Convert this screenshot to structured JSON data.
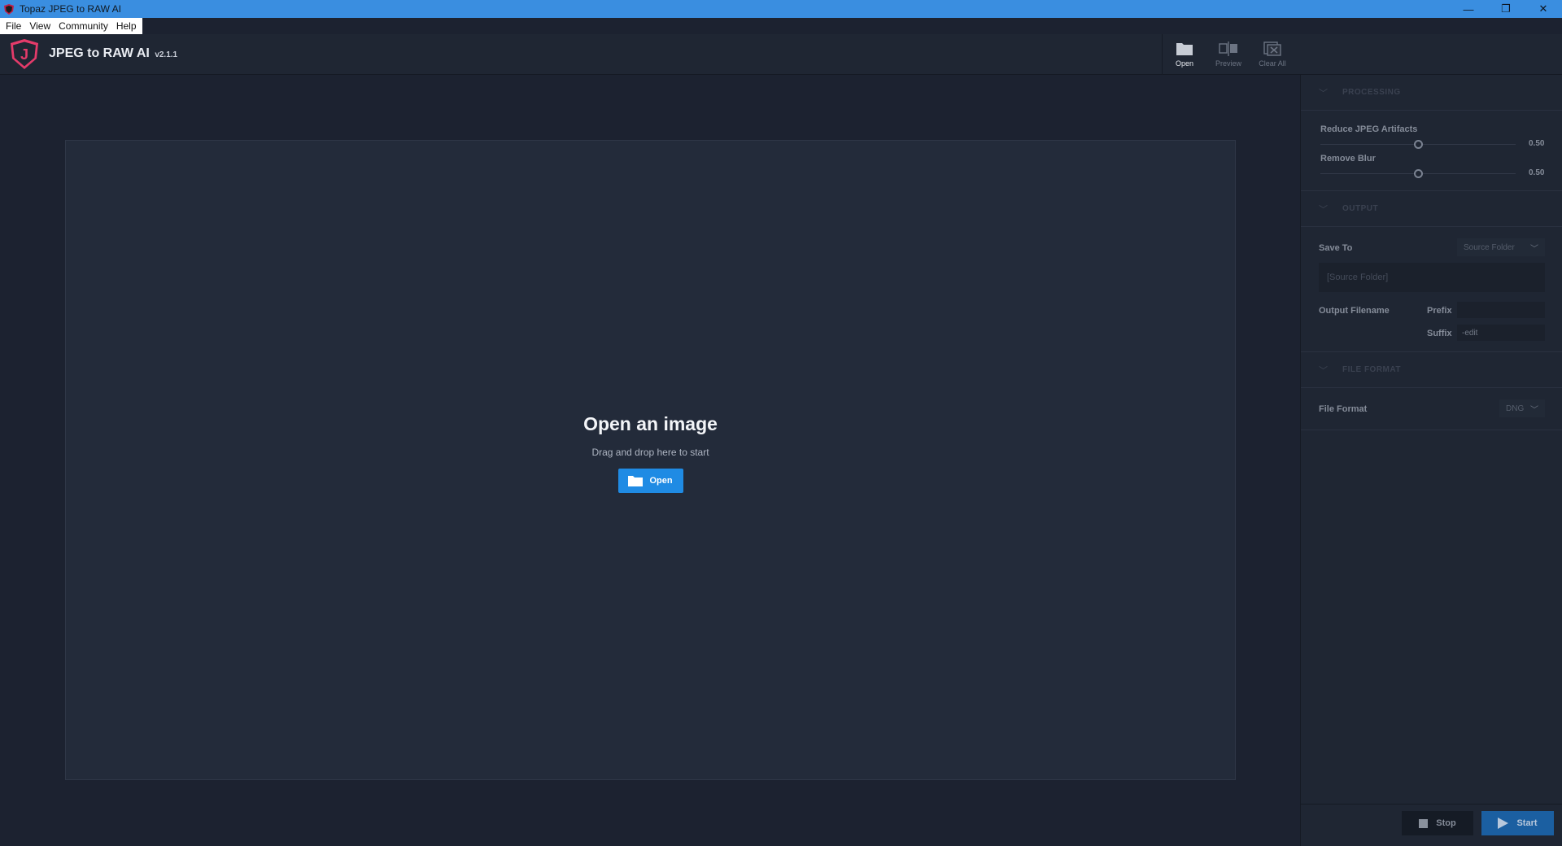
{
  "window": {
    "title": "Topaz JPEG to RAW AI",
    "controls": {
      "minimize": "—",
      "restore": "❐",
      "close": "✕"
    }
  },
  "menu": {
    "items": [
      "File",
      "View",
      "Community",
      "Help"
    ]
  },
  "header": {
    "brand": "JPEG to RAW AI",
    "version": "v2.1.1",
    "logo_letter": "J",
    "toolbar": [
      {
        "label": "Open",
        "icon": "folder-icon",
        "active": true
      },
      {
        "label": "Preview",
        "icon": "split-view-icon",
        "active": false
      },
      {
        "label": "Clear All",
        "icon": "clear-all-icon",
        "active": false
      }
    ]
  },
  "dropzone": {
    "title": "Open an image",
    "subtitle": "Drag and drop here to start",
    "open_button": "Open"
  },
  "panel": {
    "processing": {
      "heading": "PROCESSING",
      "reduce_artifacts": {
        "label": "Reduce JPEG Artifacts",
        "value": "0.50"
      },
      "remove_blur": {
        "label": "Remove Blur",
        "value": "0.50"
      }
    },
    "output": {
      "heading": "OUTPUT",
      "save_to_label": "Save To",
      "save_to_value": "Source Folder",
      "path_placeholder": "[Source Folder]",
      "filename_label": "Output Filename",
      "prefix_label": "Prefix",
      "prefix_value": "",
      "suffix_label": "Suffix",
      "suffix_value": "-edit"
    },
    "file_format": {
      "heading": "FILE FORMAT",
      "label": "File Format",
      "value": "DNG"
    },
    "actions": {
      "stop": "Stop",
      "start": "Start"
    }
  },
  "colors": {
    "accent": "#1f8be4",
    "titlebar": "#3a8ee0",
    "logo": "#e43b6a"
  }
}
